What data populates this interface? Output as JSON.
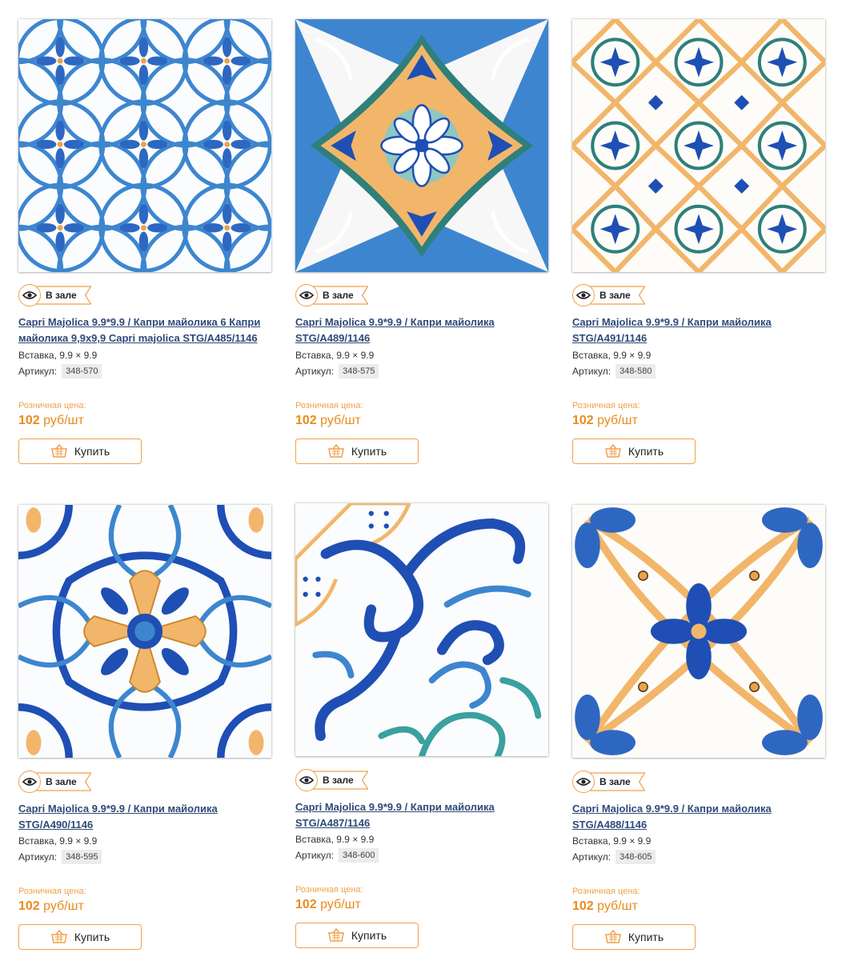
{
  "products": [
    {
      "badge": "В зале",
      "title": "Capri Majolica 9.9*9.9 / Капри майолика 6 Капри майолика 9,9x9,9 Capri majolica STG/A485/1146",
      "size": "Вставка, 9.9 × 9.9",
      "sku_label": "Артикул:",
      "sku": "348-570",
      "price_label": "Розничная цена:",
      "price_value": "102",
      "price_unit": "руб/шт",
      "buy_label": "Купить"
    },
    {
      "badge": "В зале",
      "title": "Capri Majolica 9.9*9.9 / Капри майолика STG/A489/1146",
      "size": "Вставка, 9.9 × 9.9",
      "sku_label": "Артикул:",
      "sku": "348-575",
      "price_label": "Розничная цена:",
      "price_value": "102",
      "price_unit": "руб/шт",
      "buy_label": "Купить"
    },
    {
      "badge": "В зале",
      "title": "Capri Majolica 9.9*9.9 / Капри майолика STG/A491/1146",
      "size": "Вставка, 9.9 × 9.9",
      "sku_label": "Артикул:",
      "sku": "348-580",
      "price_label": "Розничная цена:",
      "price_value": "102",
      "price_unit": "руб/шт",
      "buy_label": "Купить"
    },
    {
      "badge": "В зале",
      "title": "Capri Majolica 9.9*9.9 / Капри майолика STG/A490/1146",
      "size": "Вставка, 9.9 × 9.9",
      "sku_label": "Артикул:",
      "sku": "348-595",
      "price_label": "Розничная цена:",
      "price_value": "102",
      "price_unit": "руб/шт",
      "buy_label": "Купить"
    },
    {
      "badge": "В зале",
      "title": "Capri Majolica 9.9*9.9 / Капри майолика STG/A487/1146",
      "size": "Вставка, 9.9 × 9.9",
      "sku_label": "Артикул:",
      "sku": "348-600",
      "price_label": "Розничная цена:",
      "price_value": "102",
      "price_unit": "руб/шт",
      "buy_label": "Купить"
    },
    {
      "badge": "В зале",
      "title": "Capri Majolica 9.9*9.9 / Капри майолика STG/A488/1146",
      "size": "Вставка, 9.9 × 9.9",
      "sku_label": "Артикул:",
      "sku": "348-605",
      "price_label": "Розничная цена:",
      "price_value": "102",
      "price_unit": "руб/шт",
      "buy_label": "Купить"
    }
  ],
  "icons": {
    "badge": "eye-icon",
    "buy": "basket-icon"
  },
  "colors": {
    "accent": "#f0a14a",
    "price": "#e98b1b",
    "link": "#2f4a78",
    "tile_blue": "#1f4fb4",
    "tile_light_blue": "#3d86cf",
    "tile_orange": "#f2b66a",
    "tile_teal": "#2f7f7a"
  }
}
